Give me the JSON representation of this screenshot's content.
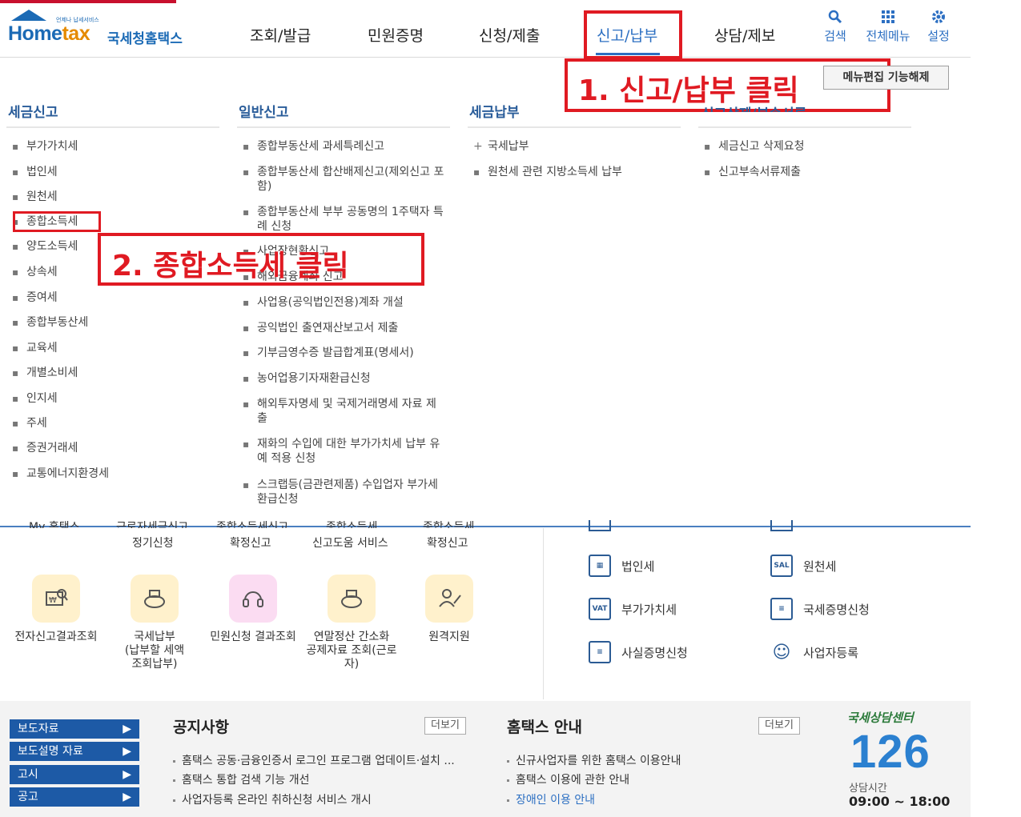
{
  "header": {
    "logo": {
      "small": "언제나 납세서비스",
      "brand_home": "Home",
      "brand_tax": "tax",
      "korean_name": "국세청홈택스"
    },
    "nav": [
      "조회/발급",
      "민원증명",
      "신청/제출",
      "신고/납부",
      "상담/제보"
    ],
    "util": [
      {
        "icon": "search-icon",
        "label": "검색"
      },
      {
        "icon": "grid-menu-icon",
        "label": "전체메뉴"
      },
      {
        "icon": "gear-icon",
        "label": "설정"
      }
    ]
  },
  "annotations": {
    "step1": "1. 신고/납부 클릭",
    "step2": "2. 종합소득세 클릭",
    "color": "#e01a22"
  },
  "menu_edit_button": "메뉴편집 기능해제",
  "mega_menu": {
    "col1": {
      "title": "세금신고",
      "items": [
        "부가가치세",
        "법인세",
        "원천세",
        "종합소득세",
        "양도소득세",
        "상속세",
        "증여세",
        "종합부동산세",
        "교육세",
        "개별소비세",
        "인지세",
        "주세",
        "증권거래세",
        "교통에너지환경세"
      ]
    },
    "col2": {
      "title": "일반신고",
      "items": [
        "종합부동산세 과세특례신고",
        "종합부동산세 합산배제신고(제외신고 포함)",
        "종합부동산세 부부 공동명의 1주택자 특례 신청",
        "사업장현황신고",
        "해외금융계좌 신고",
        "사업용(공익법인전용)계좌 개설",
        "공익법인 출연재산보고서 제출",
        "기부금영수증 발급합계표(명세서)",
        "농어업용기자재환급신청",
        "해외투자명세 및 국제거래명세 자료 제출",
        "재화의 수입에 대한 부가가치세 납부 유예 적용 신청",
        "스크랩등(금관련제품) 수입업자 부가세 환급신청"
      ]
    },
    "col3": {
      "title": "세금납부",
      "items": [
        "국세납부",
        "원천세 관련 지방소득세 납부"
      ]
    },
    "col4": {
      "title": "신고삭제/부속서류",
      "items": [
        "세금신고 삭제요청",
        "신고부속서류제출"
      ]
    }
  },
  "lower": {
    "cut_row": [
      "My 홈택스",
      "근로자세금신고",
      "종합소득세신고",
      "종합소득세",
      "종합소득세"
    ],
    "row2": [
      "정기신청",
      "확정신고",
      "신고도움 서비스",
      "확정신고"
    ],
    "quick": [
      {
        "icon": "search-doc-icon",
        "label": "전자신고결과조회"
      },
      {
        "icon": "tax-payment-icon",
        "label": "국세납부\n(납부할 세액\n조회납부)"
      },
      {
        "icon": "headset-icon",
        "label": "민원신청 결과조회"
      },
      {
        "icon": "year-end-icon",
        "label": "연말정산 간소화\n공제자료 조회(근로\n자)"
      },
      {
        "icon": "remote-support-icon",
        "label": "원격지원"
      }
    ],
    "right_links": [
      {
        "icon": "building-icon",
        "glyph": "▦",
        "label": "법인세"
      },
      {
        "icon": "salary-icon",
        "glyph": "SAL",
        "label": "원천세"
      },
      {
        "icon": "vat-icon",
        "glyph": "VAT",
        "label": "부가가치세"
      },
      {
        "icon": "certificate-icon",
        "glyph": "≡",
        "label": "국세증명신청"
      },
      {
        "icon": "document-icon",
        "glyph": "≡",
        "label": "사실증명신청"
      },
      {
        "icon": "person-icon",
        "glyph": "☺",
        "label": "사업자등록"
      }
    ]
  },
  "bottom": {
    "buttons": [
      "보도자료",
      "보도설명 자료",
      "고시",
      "공고"
    ],
    "notice": {
      "title": "공지사항",
      "more": "더보기",
      "items": [
        "홈택스 공동·금융인증서 로그인 프로그램 업데이트·설치 ...",
        "홈택스 통합 검색 기능 개선",
        "사업자등록 온라인 취하신청 서비스 개시"
      ]
    },
    "guide": {
      "title": "홈택스 안내",
      "more": "더보기",
      "items": [
        "신규사업자를 위한 홈택스 이용안내",
        "홈택스 이용에 관한 안내",
        "장애인 이용 안내"
      ]
    },
    "call_center": {
      "title": "국세상담센터",
      "number": "126",
      "hours_label": "상담시간",
      "hours": "09:00 ~ 18:00"
    }
  }
}
